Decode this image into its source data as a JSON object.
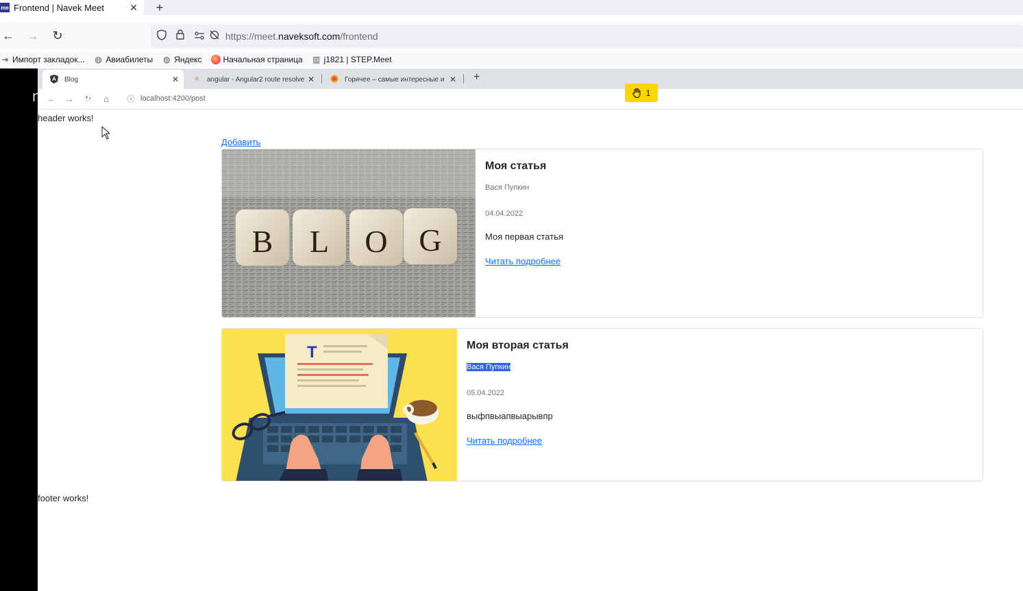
{
  "outer_browser": {
    "tab": {
      "favicon": "me",
      "title": "Frontend | Navek Meet",
      "close": "✕"
    },
    "new_tab": "+",
    "nav": {
      "back": "←",
      "forward": "→",
      "reload": "↻"
    },
    "url": {
      "prefix": "https://meet.",
      "domain": "naveksoft.com",
      "path": "/frontend"
    },
    "bookmarks": [
      {
        "icon": "import-icon",
        "label": "Импорт закладок..."
      },
      {
        "icon": "globe-icon",
        "label": "Авиабилеты"
      },
      {
        "icon": "globe-icon",
        "label": "Яндекс"
      },
      {
        "icon": "firefox-icon",
        "label": "Начальная страница"
      },
      {
        "icon": "step-icon",
        "label": "j1821 | STEP.Meet"
      }
    ]
  },
  "inner_browser": {
    "tabs": [
      {
        "icon": "angular-icon",
        "title": "Blog"
      },
      {
        "icon": "stackoverflow-icon",
        "title": "angular - Angular2 route resolve"
      },
      {
        "icon": "pikabu-icon",
        "title": "Горячее – самые интересные и"
      }
    ],
    "new_tab": "+",
    "url": "localhost:4200/post",
    "ghost_overlay": "naveksoft"
  },
  "hand_badge": {
    "icon": "hand-icon",
    "count": "1"
  },
  "page": {
    "header_text": "header works!",
    "footer_text": "footer works!",
    "add_link": "Добавить",
    "posts": [
      {
        "image": "blog-cubes-image",
        "image_letters": [
          "B",
          "L",
          "O",
          "G"
        ],
        "title": "Моя статья",
        "author": "Вася Пупкин",
        "date": "04.04.2022",
        "text": "Моя первая статья",
        "link": "Читать подробнее",
        "author_selected": false
      },
      {
        "image": "laptop-typing-image",
        "image_letters": [
          "T"
        ],
        "title": "Моя вторая статья",
        "author": "Вася Пупкин",
        "date": "05.04.2022",
        "text": "выфпвыапвыарывпр",
        "link": "Читать подробнее",
        "author_selected": true
      }
    ]
  },
  "colors": {
    "link": "#0d6efd",
    "selection": "#2d63e6",
    "badge": "#ffd500",
    "blog_bg": "#9c9b97",
    "laptop_bg": "#fbe14f"
  }
}
